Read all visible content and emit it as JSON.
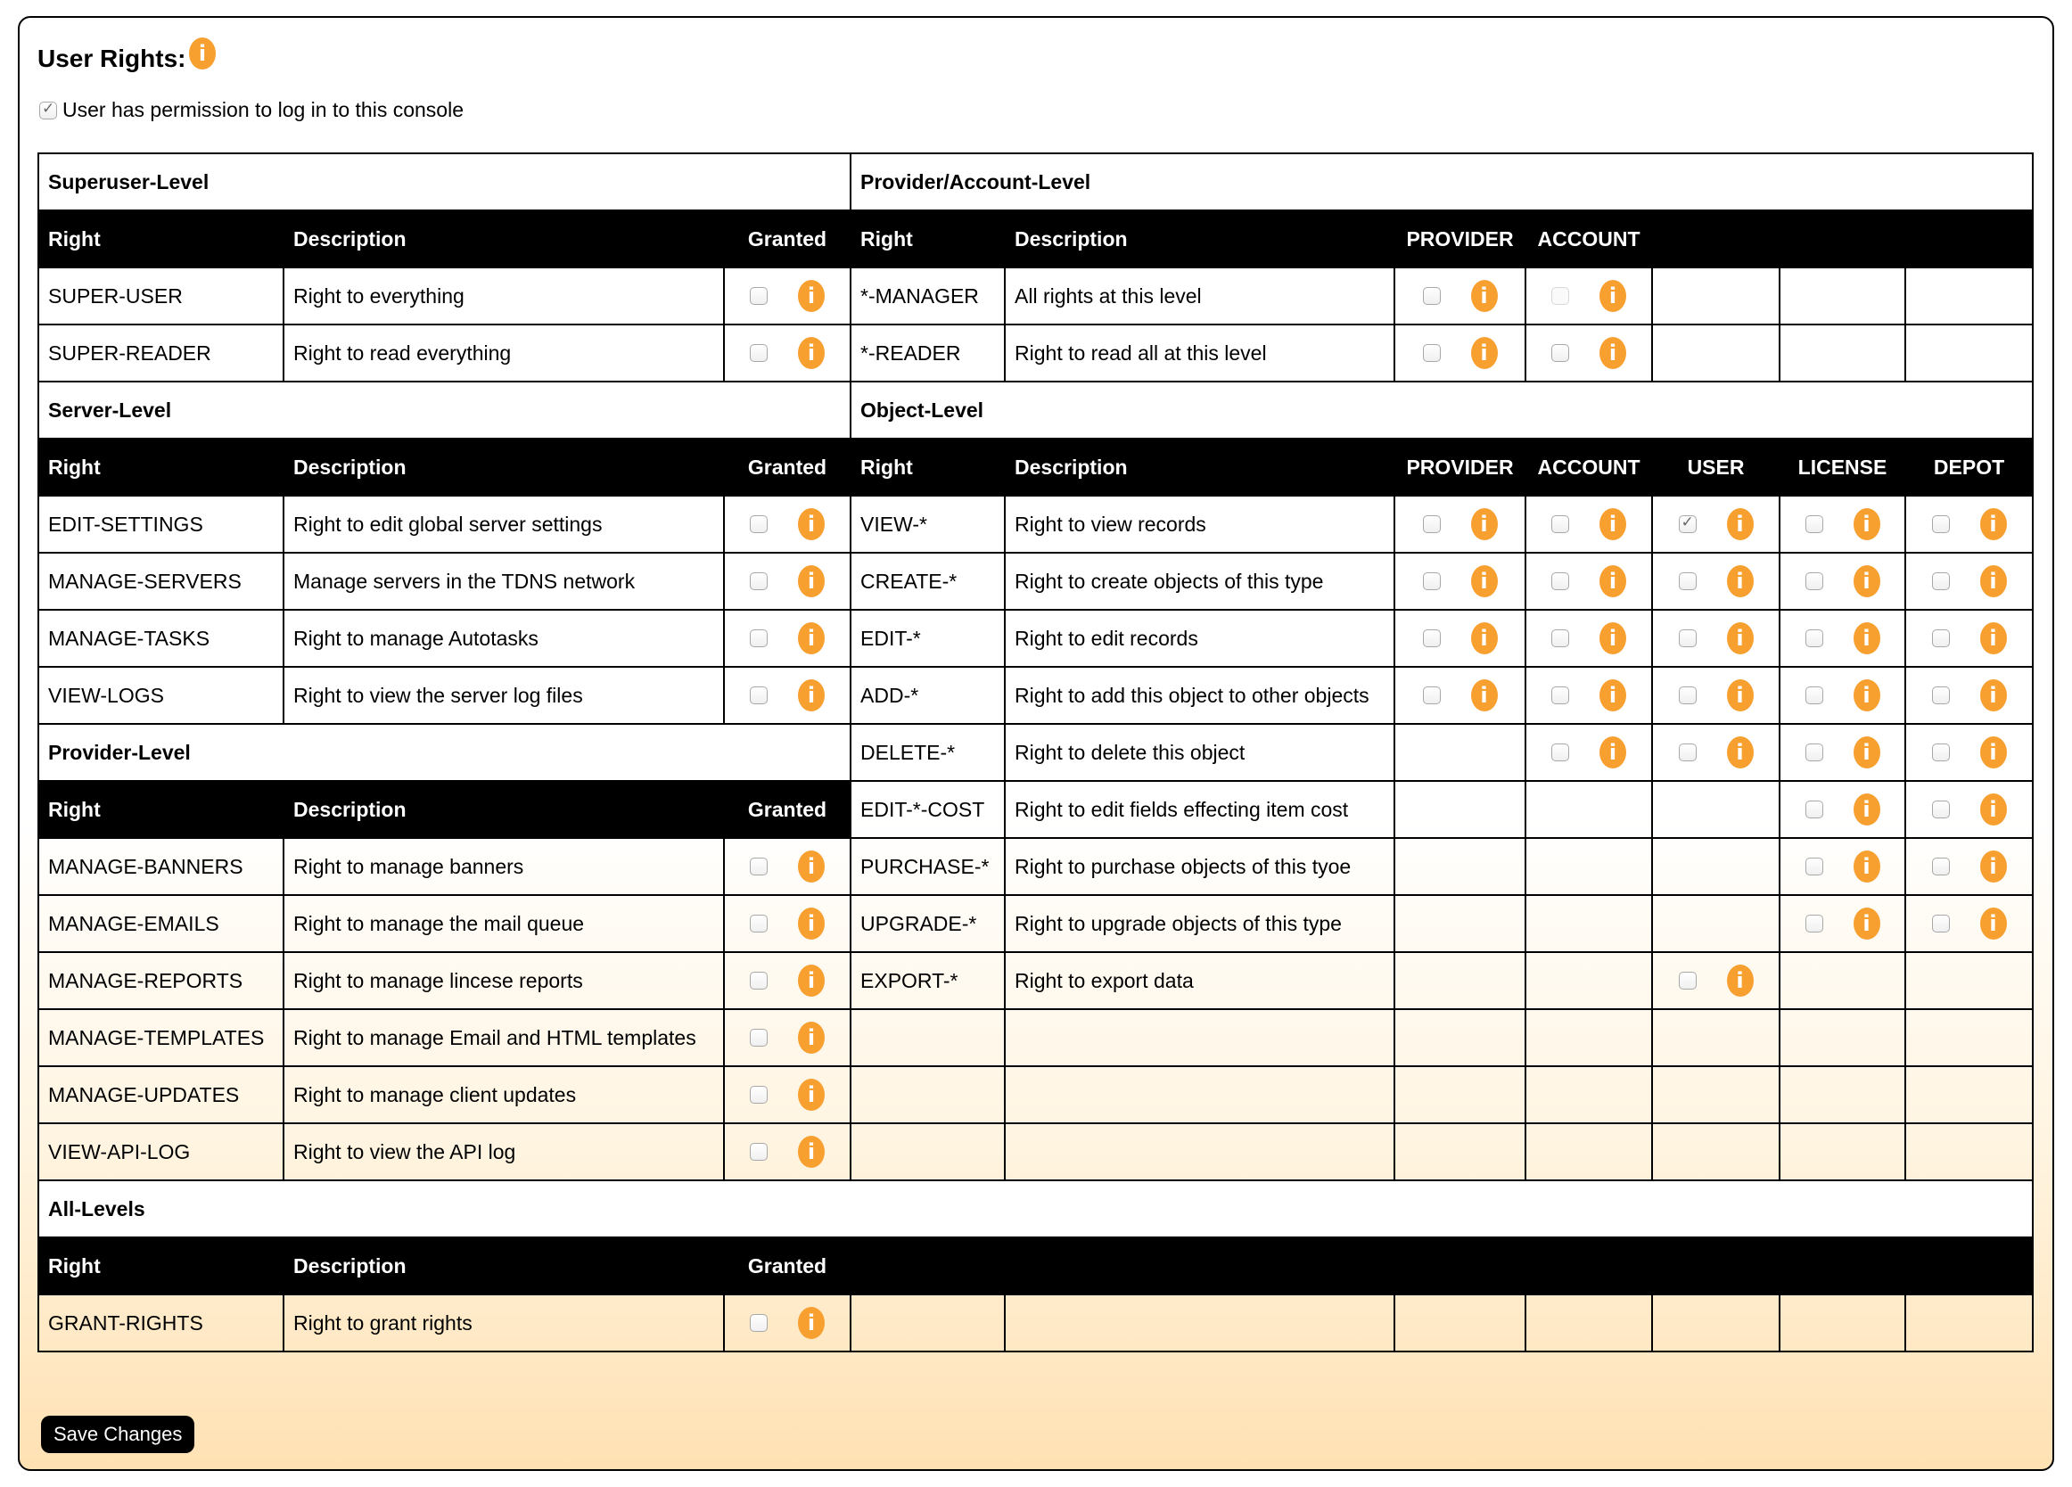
{
  "title": "User Rights:",
  "login_permission": {
    "label": "User has permission to log in to this console",
    "checked": true
  },
  "headers": {
    "right": "Right",
    "description": "Description",
    "granted": "Granted",
    "provider": "PROVIDER",
    "account": "ACCOUNT",
    "user": "USER",
    "license": "LICENSE",
    "depot": "DEPOT"
  },
  "sections": {
    "superuser": "Superuser-Level",
    "provider_account": "Provider/Account-Level",
    "server": "Server-Level",
    "object": "Object-Level",
    "provider": "Provider-Level",
    "all": "All-Levels"
  },
  "superuser_rights": [
    {
      "right": "SUPER-USER",
      "description": "Right to everything",
      "granted": false
    },
    {
      "right": "SUPER-READER",
      "description": "Right to read everything",
      "granted": false
    }
  ],
  "provider_account_rights": [
    {
      "right": "*-MANAGER",
      "description": "All rights at this level",
      "provider": "unchecked",
      "account": "disabled"
    },
    {
      "right": "*-READER",
      "description": "Right to read all at this level",
      "provider": "unchecked",
      "account": "unchecked"
    }
  ],
  "server_rights": [
    {
      "right": "EDIT-SETTINGS",
      "description": "Right to edit global server settings",
      "granted": false
    },
    {
      "right": "MANAGE-SERVERS",
      "description": "Manage servers in the TDNS network",
      "granted": false
    },
    {
      "right": "MANAGE-TASKS",
      "description": "Right to manage Autotasks",
      "granted": false
    },
    {
      "right": "VIEW-LOGS",
      "description": "Right to view the server log files",
      "granted": false
    }
  ],
  "object_rights": [
    {
      "right": "VIEW-*",
      "description": "Right to view records",
      "provider": "unchecked",
      "account": "unchecked",
      "user": "checked",
      "license": "unchecked",
      "depot": "unchecked"
    },
    {
      "right": "CREATE-*",
      "description": "Right to create objects of this type",
      "provider": "unchecked",
      "account": "unchecked",
      "user": "unchecked",
      "license": "unchecked",
      "depot": "unchecked"
    },
    {
      "right": "EDIT-*",
      "description": "Right to edit records",
      "provider": "unchecked",
      "account": "unchecked",
      "user": "unchecked",
      "license": "unchecked",
      "depot": "unchecked"
    },
    {
      "right": "ADD-*",
      "description": "Right to add this object to other objects",
      "provider": "unchecked",
      "account": "unchecked",
      "user": "unchecked",
      "license": "unchecked",
      "depot": "unchecked"
    },
    {
      "right": "DELETE-*",
      "description": "Right to delete this object",
      "provider": null,
      "account": "unchecked",
      "user": "unchecked",
      "license": "unchecked",
      "depot": "unchecked"
    },
    {
      "right": "EDIT-*-COST",
      "description": "Right to edit fields effecting item cost",
      "provider": null,
      "account": null,
      "user": null,
      "license": "unchecked",
      "depot": "unchecked"
    },
    {
      "right": "PURCHASE-*",
      "description": "Right to purchase objects of this tyoe",
      "provider": null,
      "account": null,
      "user": null,
      "license": "unchecked",
      "depot": "unchecked"
    },
    {
      "right": "UPGRADE-*",
      "description": "Right to upgrade objects of this type",
      "provider": null,
      "account": null,
      "user": null,
      "license": "unchecked",
      "depot": "unchecked"
    },
    {
      "right": "EXPORT-*",
      "description": "Right to export data",
      "provider": null,
      "account": null,
      "user": "unchecked",
      "license": null,
      "depot": null
    }
  ],
  "provider_rights": [
    {
      "right": "MANAGE-BANNERS",
      "description": "Right to manage banners",
      "granted": false
    },
    {
      "right": "MANAGE-EMAILS",
      "description": "Right to manage the mail queue",
      "granted": false
    },
    {
      "right": "MANAGE-REPORTS",
      "description": "Right to manage lincese reports",
      "granted": false
    },
    {
      "right": "MANAGE-TEMPLATES",
      "description": "Right to manage Email and HTML templates",
      "granted": false
    },
    {
      "right": "MANAGE-UPDATES",
      "description": "Right to manage client updates",
      "granted": false
    },
    {
      "right": "VIEW-API-LOG",
      "description": "Right to view the API log",
      "granted": false
    }
  ],
  "all_rights": [
    {
      "right": "GRANT-RIGHTS",
      "description": "Right to grant rights",
      "granted": false
    }
  ],
  "save_button": "Save Changes",
  "colors": {
    "info_icon": "#f7a030",
    "header_bg": "#000000",
    "panel_bottom": "#ffe1b3"
  }
}
